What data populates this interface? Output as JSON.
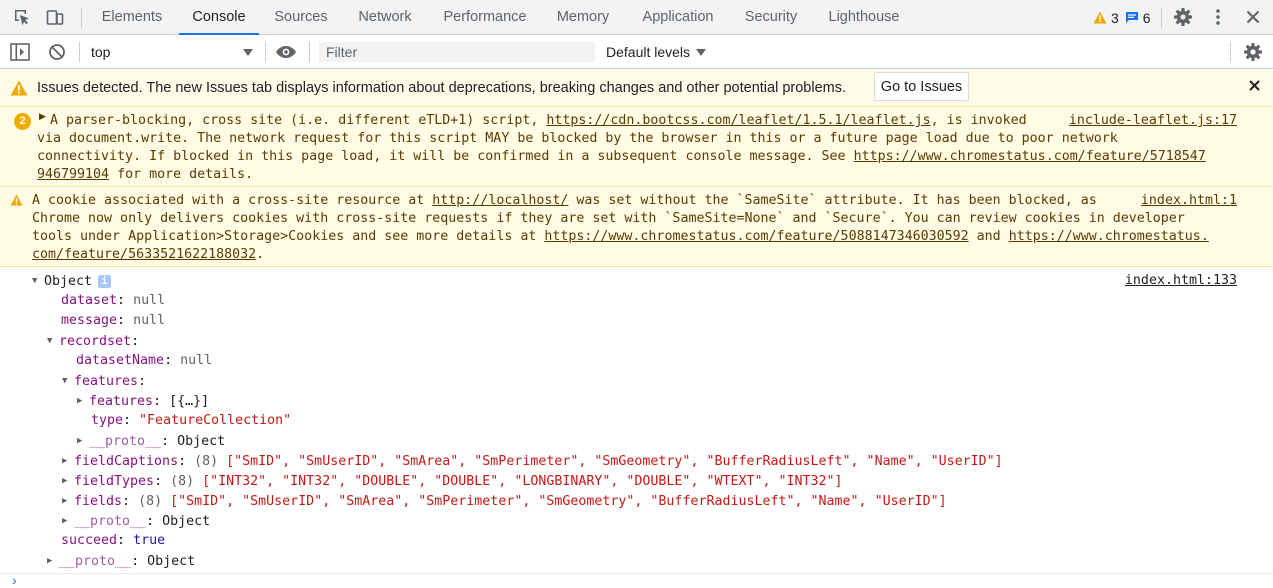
{
  "tabs": [
    "Elements",
    "Console",
    "Sources",
    "Network",
    "Performance",
    "Memory",
    "Application",
    "Security",
    "Lighthouse"
  ],
  "badges": {
    "warnings": "3",
    "messages": "6"
  },
  "toolbar": {
    "context": "top",
    "filter_placeholder": "Filter",
    "levels": "Default levels"
  },
  "issues_banner": {
    "text": "Issues detected. The new Issues tab displays information about deprecations, breaking changes and other potential problems.",
    "button": "Go to Issues"
  },
  "messages": [
    {
      "count": "2",
      "lines": [
        {
          "a": "A parser-blocking, cross site (i.e. different eTLD+1) script, ",
          "link": "https://cdn.bootcss.com/leaflet/1.5.1/leaflet.js",
          "b": ", is invoked"
        },
        {
          "a": "via document.write. The network request for this script MAY be blocked by the browser in this or a future page load due to poor network"
        },
        {
          "a": "connectivity. If blocked in this page load, it will be confirmed in a subsequent console message. See ",
          "link": "https://www.chromestatus.com/feature/5718547"
        },
        {
          "link": "946799104",
          "b": " for more details."
        }
      ],
      "source": "include-leaflet.js:17"
    },
    {
      "lines": [
        {
          "a": "A cookie associated with a cross-site resource at ",
          "link": "http://localhost/",
          "b": " was set without the `SameSite` attribute. It has been blocked, as"
        },
        {
          "a": "Chrome now only delivers cookies with cross-site requests if they are set with `SameSite=None` and `Secure`. You can review cookies in developer"
        },
        {
          "a": "tools under Application>Storage>Cookies and see more details at ",
          "link": "https://www.chromestatus.com/feature/5088147346030592",
          "b": " and ",
          "link2": "https://www.chromestatus."
        },
        {
          "link": "com/feature/5633521622188032",
          "b": "."
        }
      ],
      "source": "index.html:1"
    }
  ],
  "object_log": {
    "source": "index.html:133",
    "root_label": "Object",
    "info": "i",
    "rows": [
      {
        "key": "dataset",
        "sep": ": ",
        "val": "null"
      },
      {
        "key": "message",
        "sep": ": ",
        "val": "null"
      },
      {
        "key": "recordset",
        "sep": ":"
      },
      {
        "key": "datasetName",
        "sep": ": ",
        "val": "null"
      },
      {
        "key": "features",
        "sep": ":"
      },
      {
        "key": "features",
        "sep": ": ",
        "val": "[{…}]"
      },
      {
        "key": "type",
        "sep": ": ",
        "val": "\"FeatureCollection\""
      },
      {
        "key": "__proto__",
        "sep": ": ",
        "val": "Object"
      },
      {
        "key": "fieldCaptions",
        "sep": ": ",
        "count": "(8) ",
        "val": "[\"SmID\", \"SmUserID\", \"SmArea\", \"SmPerimeter\", \"SmGeometry\", \"BufferRadiusLeft\", \"Name\", \"UserID\"]"
      },
      {
        "key": "fieldTypes",
        "sep": ": ",
        "count": "(8) ",
        "val": "[\"INT32\", \"INT32\", \"DOUBLE\", \"DOUBLE\", \"LONGBINARY\", \"DOUBLE\", \"WTEXT\", \"INT32\"]"
      },
      {
        "key": "fields",
        "sep": ": ",
        "count": "(8) ",
        "val": "[\"SmID\", \"SmUserID\", \"SmArea\", \"SmPerimeter\", \"SmGeometry\", \"BufferRadiusLeft\", \"Name\", \"UserID\"]"
      },
      {
        "key": "__proto__",
        "sep": ": ",
        "val": "Object"
      },
      {
        "key": "succeed",
        "sep": ": ",
        "val": "true"
      },
      {
        "key": "__proto__",
        "sep": ": ",
        "val": "Object"
      }
    ]
  },
  "prompt": "›",
  "colors": {
    "accent": "#1a73e8",
    "warning_bg": "#fffbe5",
    "warning_text": "#5c3b00",
    "badge": "#f0ab00"
  }
}
